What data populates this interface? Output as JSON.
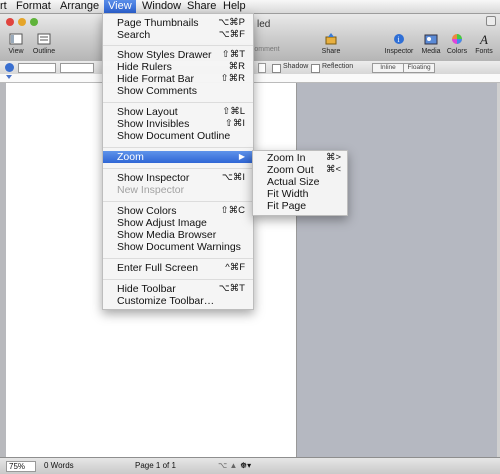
{
  "menubar": {
    "items": [
      {
        "label": "rt",
        "active": false
      },
      {
        "label": "Format",
        "active": false
      },
      {
        "label": "Arrange",
        "active": false
      },
      {
        "label": "View",
        "active": true
      },
      {
        "label": "Window",
        "active": false
      },
      {
        "label": "Share",
        "active": false
      },
      {
        "label": "Help",
        "active": false
      }
    ]
  },
  "window": {
    "title_fragment": "led",
    "toolbar": {
      "view_label": "View",
      "outline_label": "Outline",
      "comment_label": "omment",
      "share_label": "Share",
      "inspector_label": "Inspector",
      "media_label": "Media",
      "colors_label": "Colors",
      "fonts_label": "Fonts"
    },
    "formatbar": {
      "shadow_label": "Shadow",
      "reflection_label": "Reflection",
      "inline_label": "Inline",
      "floating_label": "Floating"
    },
    "status": {
      "zoom": "75%",
      "words": "0 Words",
      "page": "Page 1 of 1"
    }
  },
  "view_menu": {
    "items": [
      {
        "label": "Page Thumbnails",
        "shortcut": "⌥⌘P",
        "enabled": true
      },
      {
        "label": "Search",
        "shortcut": "⌥⌘F",
        "enabled": true
      },
      {
        "label": "Show Styles Drawer",
        "shortcut": "⇧⌘T",
        "enabled": true
      },
      {
        "label": "Hide Rulers",
        "shortcut": "⌘R",
        "enabled": true
      },
      {
        "label": "Hide Format Bar",
        "shortcut": "⇧⌘R",
        "enabled": true
      },
      {
        "label": "Show Comments",
        "shortcut": "",
        "enabled": true
      },
      {
        "label": "Show Layout",
        "shortcut": "⇧⌘L",
        "enabled": true
      },
      {
        "label": "Show Invisibles",
        "shortcut": "⇧⌘I",
        "enabled": true
      },
      {
        "label": "Show Document Outline",
        "shortcut": "",
        "enabled": true
      },
      {
        "label": "Zoom",
        "shortcut": "",
        "enabled": true,
        "submenu": true
      },
      {
        "label": "Show Inspector",
        "shortcut": "⌥⌘I",
        "enabled": true
      },
      {
        "label": "New Inspector",
        "shortcut": "",
        "enabled": false
      },
      {
        "label": "Show Colors",
        "shortcut": "⇧⌘C",
        "enabled": true
      },
      {
        "label": "Show Adjust Image",
        "shortcut": "",
        "enabled": true
      },
      {
        "label": "Show Media Browser",
        "shortcut": "",
        "enabled": true
      },
      {
        "label": "Show Document Warnings",
        "shortcut": "",
        "enabled": true
      },
      {
        "label": "Enter Full Screen",
        "shortcut": "^⌘F",
        "enabled": true
      },
      {
        "label": "Hide Toolbar",
        "shortcut": "⌥⌘T",
        "enabled": true
      },
      {
        "label": "Customize Toolbar…",
        "shortcut": "",
        "enabled": true
      }
    ]
  },
  "zoom_submenu": {
    "items": [
      {
        "label": "Zoom In",
        "shortcut": "⌘>"
      },
      {
        "label": "Zoom Out",
        "shortcut": "⌘<"
      },
      {
        "label": "Actual Size",
        "shortcut": ""
      },
      {
        "label": "Fit Width",
        "shortcut": ""
      },
      {
        "label": "Fit Page",
        "shortcut": ""
      }
    ]
  },
  "icons": [
    "view-icon",
    "outline-icon",
    "comment-icon",
    "share-icon",
    "inspector-icon",
    "media-icon",
    "colors-icon",
    "fonts-icon",
    "submenu-arrow-icon"
  ]
}
